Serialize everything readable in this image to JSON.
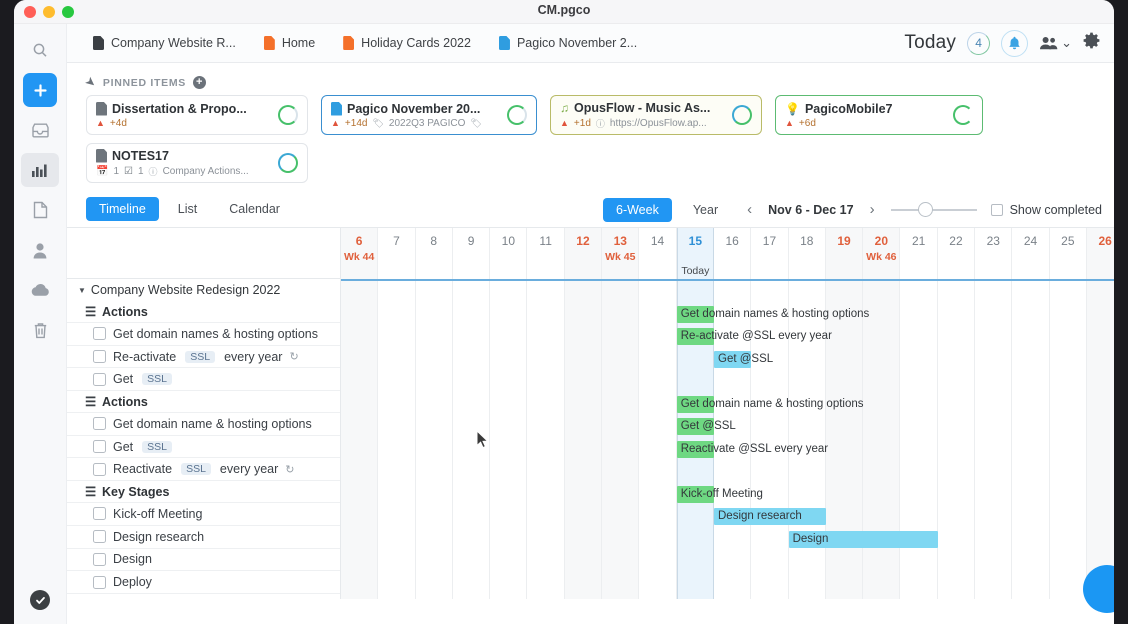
{
  "window": {
    "title": "CM.pgco"
  },
  "rail": {
    "items": [
      {
        "name": "search",
        "icon": "search-icon"
      },
      {
        "name": "add",
        "icon": "plus-icon"
      },
      {
        "name": "inbox",
        "icon": "inbox-icon"
      },
      {
        "name": "dashboard",
        "icon": "chart-icon"
      },
      {
        "name": "documents",
        "icon": "file-icon"
      },
      {
        "name": "contacts",
        "icon": "person-icon"
      },
      {
        "name": "cloud",
        "icon": "cloud-icon"
      },
      {
        "name": "trash",
        "icon": "trash-icon"
      }
    ],
    "bottom": {
      "name": "sync-status",
      "icon": "check-circle-icon"
    }
  },
  "tabs": [
    {
      "label": "Company Website R...",
      "icon": "file-icon",
      "color": "dark"
    },
    {
      "label": "Home",
      "icon": "file-icon",
      "color": "orange"
    },
    {
      "label": "Holiday Cards 2022",
      "icon": "file-icon",
      "color": "orange"
    },
    {
      "label": "Pagico November 2...",
      "icon": "file-icon",
      "color": "blue"
    }
  ],
  "topright": {
    "today_label": "Today",
    "today_count": "4",
    "bell_icon": "bell-icon",
    "people_icon": "people-icon",
    "people_caret": "⌄",
    "gear_icon": "gear-icon"
  },
  "pinned": {
    "header": "PINNED ITEMS",
    "add_label": "+",
    "cards": [
      {
        "title": "Dissertation & Propo...",
        "icon": "file-icon",
        "due": "+4d",
        "meta": "",
        "style": "plain",
        "ring": "green"
      },
      {
        "title": "Pagico November 20...",
        "icon": "file-icon",
        "due": "+14d",
        "meta": "2022Q3 PAGICO",
        "style": "sel-blue",
        "ring": "green"
      },
      {
        "title": "OpusFlow - Music As...",
        "icon": "music-icon",
        "due": "+1d",
        "meta": "https://OpusFlow.ap...",
        "style": "sel-olive",
        "ring": "teal"
      },
      {
        "title": "PagicoMobile7",
        "icon": "bulb-icon",
        "due": "+6d",
        "meta": "",
        "style": "sel-green",
        "ring": "plain"
      },
      {
        "title": "NOTES17",
        "icon": "file-icon",
        "due": "",
        "meta": "1  1  Company Actions...",
        "style": "plain",
        "ring": "teal",
        "counts": [
          "1",
          "1"
        ]
      }
    ]
  },
  "viewbar": {
    "views": [
      {
        "label": "Timeline",
        "active": true
      },
      {
        "label": "List",
        "active": false
      },
      {
        "label": "Calendar",
        "active": false
      }
    ],
    "zooms": [
      {
        "label": "6-Week",
        "active": true
      },
      {
        "label": "Year",
        "active": false
      }
    ],
    "prev": "‹",
    "next": "›",
    "range": "Nov 6 - Dec 17",
    "show_completed": "Show completed",
    "show_completed_checked": false,
    "slider_value": 32
  },
  "timeline": {
    "project": "Company Website Redesign 2022",
    "days": [
      {
        "num": "6",
        "week": "Wk 44",
        "weekend": true,
        "today": false
      },
      {
        "num": "7",
        "week": "",
        "weekend": false,
        "today": false
      },
      {
        "num": "8",
        "week": "",
        "weekend": false,
        "today": false
      },
      {
        "num": "9",
        "week": "",
        "weekend": false,
        "today": false
      },
      {
        "num": "10",
        "week": "",
        "weekend": false,
        "today": false
      },
      {
        "num": "11",
        "week": "",
        "weekend": false,
        "today": false
      },
      {
        "num": "12",
        "week": "",
        "weekend": true,
        "today": false
      },
      {
        "num": "13",
        "week": "Wk 45",
        "weekend": true,
        "today": false
      },
      {
        "num": "14",
        "week": "",
        "weekend": false,
        "today": false
      },
      {
        "num": "15",
        "week": "",
        "weekend": false,
        "today": true,
        "today_label": "Today"
      },
      {
        "num": "16",
        "week": "",
        "weekend": false,
        "today": false
      },
      {
        "num": "17",
        "week": "",
        "weekend": false,
        "today": false
      },
      {
        "num": "18",
        "week": "",
        "weekend": false,
        "today": false
      },
      {
        "num": "19",
        "week": "",
        "weekend": true,
        "today": false
      },
      {
        "num": "20",
        "week": "Wk 46",
        "weekend": true,
        "today": false
      },
      {
        "num": "21",
        "week": "",
        "weekend": false,
        "today": false
      },
      {
        "num": "22",
        "week": "",
        "weekend": false,
        "today": false
      },
      {
        "num": "23",
        "week": "",
        "weekend": false,
        "today": false
      },
      {
        "num": "24",
        "week": "",
        "weekend": false,
        "today": false
      },
      {
        "num": "25",
        "week": "",
        "weekend": false,
        "today": false
      },
      {
        "num": "26",
        "week": "",
        "weekend": true,
        "today": false
      }
    ],
    "rows": [
      {
        "kind": "group",
        "label": "Actions"
      },
      {
        "kind": "task",
        "label": "Get domain names & hosting options",
        "bar": {
          "label": "Get domain names & hosting options",
          "color": "green",
          "start": 9,
          "span": 1
        }
      },
      {
        "kind": "task",
        "label": "Re-activate",
        "chip": "SSL",
        "label2": "every year",
        "recur": true,
        "bar": {
          "label": "Re-activate @SSL every year",
          "color": "green",
          "start": 9,
          "span": 1
        }
      },
      {
        "kind": "task",
        "label": "Get",
        "chip": "SSL",
        "bar": {
          "label": "Get @SSL",
          "color": "blue",
          "start": 10,
          "span": 1
        }
      },
      {
        "kind": "group",
        "label": "Actions"
      },
      {
        "kind": "task",
        "label": "Get domain name & hosting options",
        "bar": {
          "label": "Get domain name & hosting options",
          "color": "green",
          "start": 9,
          "span": 1
        }
      },
      {
        "kind": "task",
        "label": "Get",
        "chip": "SSL",
        "bar": {
          "label": "Get @SSL",
          "color": "green",
          "start": 9,
          "span": 1
        }
      },
      {
        "kind": "task",
        "label": "Reactivate",
        "chip": "SSL",
        "label2": "every year",
        "recur": true,
        "bar": {
          "label": "Reactivate @SSL every year",
          "color": "green",
          "start": 9,
          "span": 1
        }
      },
      {
        "kind": "group",
        "label": "Key Stages"
      },
      {
        "kind": "task",
        "label": "Kick-off Meeting",
        "bar": {
          "label": "Kick-off Meeting",
          "color": "green",
          "start": 9,
          "span": 1
        }
      },
      {
        "kind": "task",
        "label": "Design research",
        "bar": {
          "label": "Design research",
          "color": "blue",
          "start": 10,
          "span": 3
        }
      },
      {
        "kind": "task",
        "label": "Design",
        "bar": {
          "label": "Design",
          "color": "blue",
          "start": 12,
          "span": 4
        }
      },
      {
        "kind": "task",
        "label": "Deploy"
      }
    ]
  },
  "fab": {
    "name": "help-button"
  }
}
